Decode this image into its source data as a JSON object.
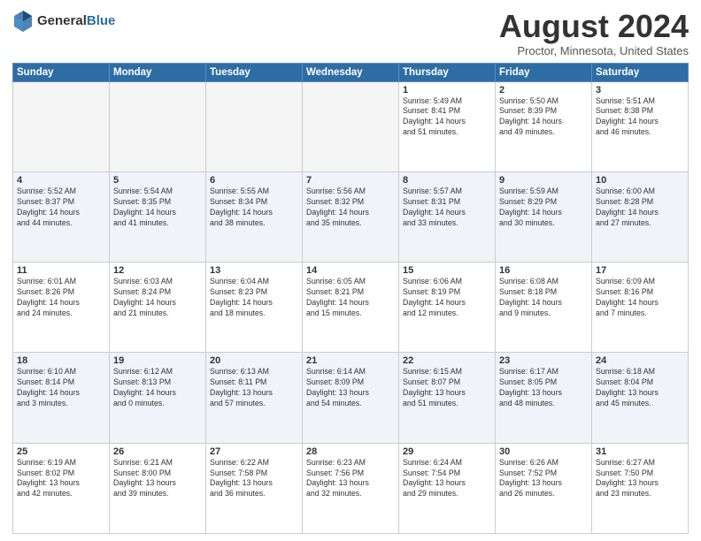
{
  "header": {
    "logo_general": "General",
    "logo_blue": "Blue",
    "month": "August 2024",
    "location": "Proctor, Minnesota, United States"
  },
  "days_of_week": [
    "Sunday",
    "Monday",
    "Tuesday",
    "Wednesday",
    "Thursday",
    "Friday",
    "Saturday"
  ],
  "weeks": [
    [
      {
        "day": "",
        "info": ""
      },
      {
        "day": "",
        "info": ""
      },
      {
        "day": "",
        "info": ""
      },
      {
        "day": "",
        "info": ""
      },
      {
        "day": "1",
        "info": "Sunrise: 5:49 AM\nSunset: 8:41 PM\nDaylight: 14 hours\nand 51 minutes."
      },
      {
        "day": "2",
        "info": "Sunrise: 5:50 AM\nSunset: 8:39 PM\nDaylight: 14 hours\nand 49 minutes."
      },
      {
        "day": "3",
        "info": "Sunrise: 5:51 AM\nSunset: 8:38 PM\nDaylight: 14 hours\nand 46 minutes."
      }
    ],
    [
      {
        "day": "4",
        "info": "Sunrise: 5:52 AM\nSunset: 8:37 PM\nDaylight: 14 hours\nand 44 minutes."
      },
      {
        "day": "5",
        "info": "Sunrise: 5:54 AM\nSunset: 8:35 PM\nDaylight: 14 hours\nand 41 minutes."
      },
      {
        "day": "6",
        "info": "Sunrise: 5:55 AM\nSunset: 8:34 PM\nDaylight: 14 hours\nand 38 minutes."
      },
      {
        "day": "7",
        "info": "Sunrise: 5:56 AM\nSunset: 8:32 PM\nDaylight: 14 hours\nand 35 minutes."
      },
      {
        "day": "8",
        "info": "Sunrise: 5:57 AM\nSunset: 8:31 PM\nDaylight: 14 hours\nand 33 minutes."
      },
      {
        "day": "9",
        "info": "Sunrise: 5:59 AM\nSunset: 8:29 PM\nDaylight: 14 hours\nand 30 minutes."
      },
      {
        "day": "10",
        "info": "Sunrise: 6:00 AM\nSunset: 8:28 PM\nDaylight: 14 hours\nand 27 minutes."
      }
    ],
    [
      {
        "day": "11",
        "info": "Sunrise: 6:01 AM\nSunset: 8:26 PM\nDaylight: 14 hours\nand 24 minutes."
      },
      {
        "day": "12",
        "info": "Sunrise: 6:03 AM\nSunset: 8:24 PM\nDaylight: 14 hours\nand 21 minutes."
      },
      {
        "day": "13",
        "info": "Sunrise: 6:04 AM\nSunset: 8:23 PM\nDaylight: 14 hours\nand 18 minutes."
      },
      {
        "day": "14",
        "info": "Sunrise: 6:05 AM\nSunset: 8:21 PM\nDaylight: 14 hours\nand 15 minutes."
      },
      {
        "day": "15",
        "info": "Sunrise: 6:06 AM\nSunset: 8:19 PM\nDaylight: 14 hours\nand 12 minutes."
      },
      {
        "day": "16",
        "info": "Sunrise: 6:08 AM\nSunset: 8:18 PM\nDaylight: 14 hours\nand 9 minutes."
      },
      {
        "day": "17",
        "info": "Sunrise: 6:09 AM\nSunset: 8:16 PM\nDaylight: 14 hours\nand 7 minutes."
      }
    ],
    [
      {
        "day": "18",
        "info": "Sunrise: 6:10 AM\nSunset: 8:14 PM\nDaylight: 14 hours\nand 3 minutes."
      },
      {
        "day": "19",
        "info": "Sunrise: 6:12 AM\nSunset: 8:13 PM\nDaylight: 14 hours\nand 0 minutes."
      },
      {
        "day": "20",
        "info": "Sunrise: 6:13 AM\nSunset: 8:11 PM\nDaylight: 13 hours\nand 57 minutes."
      },
      {
        "day": "21",
        "info": "Sunrise: 6:14 AM\nSunset: 8:09 PM\nDaylight: 13 hours\nand 54 minutes."
      },
      {
        "day": "22",
        "info": "Sunrise: 6:15 AM\nSunset: 8:07 PM\nDaylight: 13 hours\nand 51 minutes."
      },
      {
        "day": "23",
        "info": "Sunrise: 6:17 AM\nSunset: 8:05 PM\nDaylight: 13 hours\nand 48 minutes."
      },
      {
        "day": "24",
        "info": "Sunrise: 6:18 AM\nSunset: 8:04 PM\nDaylight: 13 hours\nand 45 minutes."
      }
    ],
    [
      {
        "day": "25",
        "info": "Sunrise: 6:19 AM\nSunset: 8:02 PM\nDaylight: 13 hours\nand 42 minutes."
      },
      {
        "day": "26",
        "info": "Sunrise: 6:21 AM\nSunset: 8:00 PM\nDaylight: 13 hours\nand 39 minutes."
      },
      {
        "day": "27",
        "info": "Sunrise: 6:22 AM\nSunset: 7:58 PM\nDaylight: 13 hours\nand 36 minutes."
      },
      {
        "day": "28",
        "info": "Sunrise: 6:23 AM\nSunset: 7:56 PM\nDaylight: 13 hours\nand 32 minutes."
      },
      {
        "day": "29",
        "info": "Sunrise: 6:24 AM\nSunset: 7:54 PM\nDaylight: 13 hours\nand 29 minutes."
      },
      {
        "day": "30",
        "info": "Sunrise: 6:26 AM\nSunset: 7:52 PM\nDaylight: 13 hours\nand 26 minutes."
      },
      {
        "day": "31",
        "info": "Sunrise: 6:27 AM\nSunset: 7:50 PM\nDaylight: 13 hours\nand 23 minutes."
      }
    ]
  ]
}
